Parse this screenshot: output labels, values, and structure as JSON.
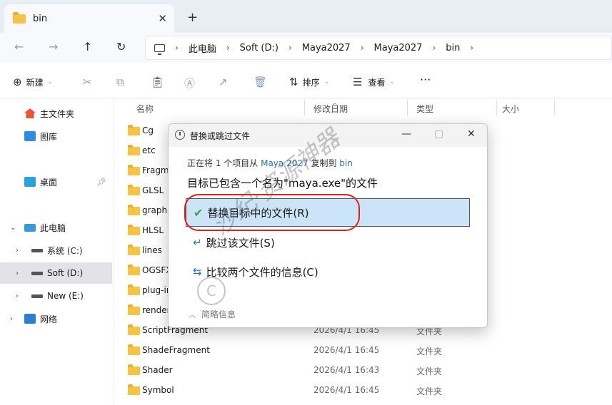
{
  "tab": {
    "title": "bin",
    "close": "✕",
    "new_tab": "+"
  },
  "nav": {
    "back": "←",
    "forward": "→",
    "up": "↑",
    "refresh": "↻"
  },
  "breadcrumbs": [
    "此电脑",
    "Soft (D:)",
    "Maya2027",
    "Maya2027",
    "bin"
  ],
  "toolbar": {
    "new_label": "新建",
    "sort_label": "排序",
    "view_label": "查看",
    "more": "···"
  },
  "sidebar": {
    "items": [
      {
        "label": "主文件夹"
      },
      {
        "label": "图库"
      },
      {
        "label": "桌面"
      },
      {
        "label": "此电脑"
      },
      {
        "label": "系统 (C:)"
      },
      {
        "label": "Soft (D:)"
      },
      {
        "label": "New (E:)"
      },
      {
        "label": "网络"
      }
    ]
  },
  "columns": {
    "name": "名称",
    "date": "修改日期",
    "type": "类型",
    "size": "大小"
  },
  "files": [
    {
      "name": "Cg",
      "date": "",
      "type": ""
    },
    {
      "name": "etc",
      "date": "",
      "type": ""
    },
    {
      "name": "Fragm",
      "date": "",
      "type": ""
    },
    {
      "name": "GLSL",
      "date": "",
      "type": ""
    },
    {
      "name": "graphi",
      "date": "",
      "type": ""
    },
    {
      "name": "HLSL",
      "date": "",
      "type": ""
    },
    {
      "name": "lines",
      "date": "",
      "type": ""
    },
    {
      "name": "OGSFX",
      "date": "",
      "type": ""
    },
    {
      "name": "plug-ir",
      "date": "",
      "type": ""
    },
    {
      "name": "render",
      "date": "",
      "type": ""
    },
    {
      "name": "ScriptFragment",
      "date": "2026/4/1 16:45",
      "type": "文件夹"
    },
    {
      "name": "ShadeFragment",
      "date": "2026/4/1 16:45",
      "type": "文件夹"
    },
    {
      "name": "Shader",
      "date": "2026/4/1 16:43",
      "type": "文件夹"
    },
    {
      "name": "Symbol",
      "date": "2026/4/1 16:45",
      "type": "文件夹"
    }
  ],
  "dialog": {
    "title": "替换或跳过文件",
    "line_prefix": "正在将 1 个项目从",
    "source": "Maya 2027",
    "line_mid": "复制到",
    "dest": "bin",
    "heading": "目标已包含一个名为\"maya.exe\"的文件",
    "options": {
      "replace": "替换目标中的文件(R)",
      "skip": "跳过该文件(S)",
      "compare": "比较两个文件的信息(C)"
    },
    "footer": "简略信息"
  },
  "watermark": {
    "text": "沙纪·资源神器",
    "circle": "C"
  },
  "colors": {
    "accent": "#2c6fbd",
    "highlight": "#cce4f7",
    "annotation": "#e02020",
    "folder": "#f6c445"
  }
}
